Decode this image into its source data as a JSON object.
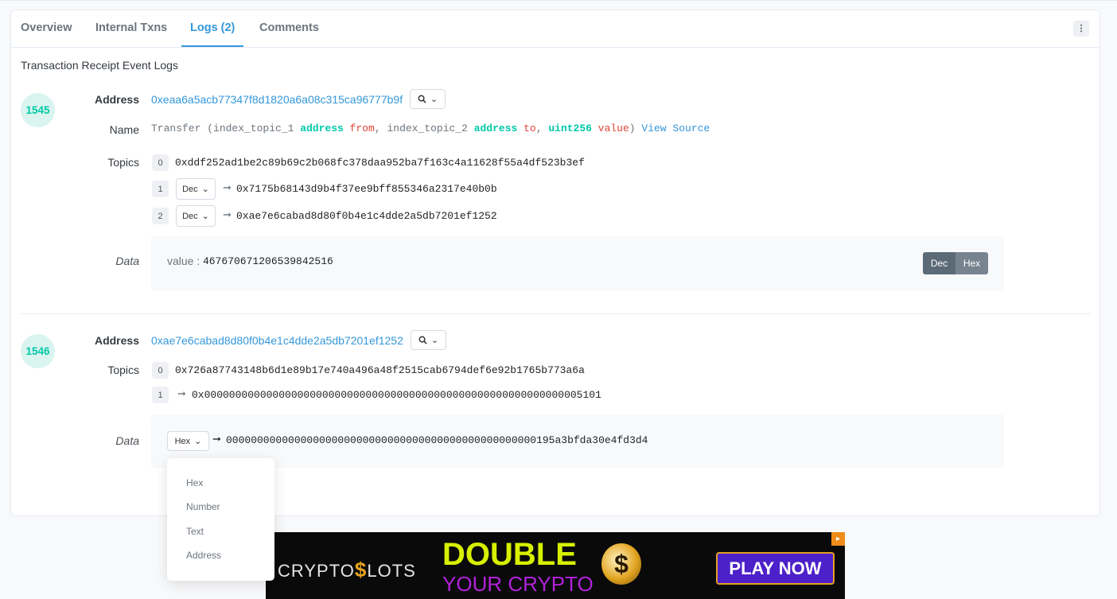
{
  "tabs": [
    {
      "label": "Overview"
    },
    {
      "label": "Internal Txns"
    },
    {
      "label": "Logs (2)"
    },
    {
      "label": "Comments"
    }
  ],
  "section_title": "Transaction Receipt Event Logs",
  "labels": {
    "address": "Address",
    "name": "Name",
    "topics": "Topics",
    "data": "Data"
  },
  "logs": [
    {
      "index": "1545",
      "address": "0xeaa6a5acb77347f8d1820a6a08c315ca96777b9f",
      "name": {
        "func": "Transfer (",
        "p1": "index_topic_1 ",
        "p1_type": "address",
        "p1_name": "from",
        "p2": ", index_topic_2 ",
        "p2_type": "address",
        "p2_name": "to",
        "sep": ", ",
        "p3_type": "uint256",
        "p3_name": "value",
        "close": ")",
        "view_source": "View Source"
      },
      "topics": [
        {
          "idx": "0",
          "value": "0xddf252ad1be2c89b69c2b068fc378daa952ba7f163c4a11628f55a4df523b3ef"
        },
        {
          "idx": "1",
          "format": "Dec",
          "value": "0x7175b68143d9b4f37ee9bff855346a2317e40b0b"
        },
        {
          "idx": "2",
          "format": "Dec",
          "value": "0xae7e6cabad8d80f0b4e1c4dde2a5db7201ef1252"
        }
      ],
      "data": {
        "label": "value : ",
        "value": "46767067120653984251​6",
        "dec_label": "Dec",
        "hex_label": "Hex"
      }
    },
    {
      "index": "1546",
      "address": "0xae7e6cabad8d80f0b4e1c4dde2a5db7201ef1252",
      "topics": [
        {
          "idx": "0",
          "value": "0x726a87743148b6d1e89b17e740a496a48f2515cab6794def6e92b1765b773a6a"
        },
        {
          "idx": "1",
          "value": "0x0000000000000000000000000000000000000000000000000000000000005101"
        }
      ],
      "data": {
        "format": "Hex",
        "value": "00000000000000000000000000000000000000000000000000195a3bfda30e4fd3d4"
      }
    }
  ],
  "dropdown": {
    "options": [
      "Hex",
      "Number",
      "Text",
      "Address"
    ]
  },
  "ad": {
    "logo_left": "CRYPTO",
    "logo_dollar": "$",
    "logo_right": "LOTS",
    "headline": "DOUBLE",
    "subline": "YOUR CRYPTO",
    "coin": "$",
    "cta": "PLAY NOW"
  },
  "colors": {
    "accent": "#3498db",
    "success": "#00c9a7",
    "danger": "#de4437"
  }
}
